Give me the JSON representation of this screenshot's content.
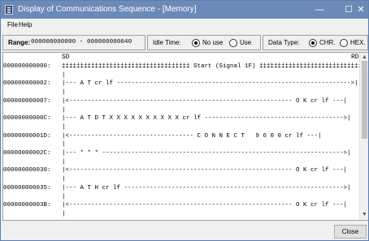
{
  "window": {
    "title": "Display of Communications Sequence - [Memory]",
    "minimize_glyph": "—",
    "maximize_glyph": "☐",
    "close_glyph": "✕"
  },
  "menu": {
    "file": "File",
    "help": "Help"
  },
  "range": {
    "label": "Range:",
    "value": "000000000000 - 000000000040"
  },
  "idle_time": {
    "label": "Idle Time:",
    "options": [
      "No use",
      "Use"
    ],
    "selected": "No use"
  },
  "data_type": {
    "label": "Data Type:",
    "options": [
      "CHR.",
      "HEX."
    ],
    "selected": "CHR."
  },
  "columns": {
    "sd": "SD",
    "rd": "RD"
  },
  "rows": [
    {
      "addr": "000000000000:",
      "data": "‡‡‡‡‡‡‡‡‡‡‡‡‡‡‡‡‡‡‡‡‡‡‡‡‡‡‡‡‡‡‡‡‡‡‡ Start (Signal 1F) ‡‡‡‡‡‡‡‡‡‡‡‡‡‡‡‡‡‡‡‡‡‡‡‡‡‡‡‡‡‡‡‡‡‡"
    },
    {
      "addr": "",
      "data": "|"
    },
    {
      "addr": "000000000002:",
      "data": "|--- A T cr lf ---------------------------------------------------------------->|"
    },
    {
      "addr": "",
      "data": "|"
    },
    {
      "addr": "000000000007:",
      "data": "|<------------------------------------------------------------- O K cr lf ---|"
    },
    {
      "addr": "",
      "data": "|"
    },
    {
      "addr": "00000000000C:",
      "data": "|--- A T D T X X X X X X X X X X cr lf -------------------------------------->|"
    },
    {
      "addr": "",
      "data": "|"
    },
    {
      "addr": "00000000001D:",
      "data": "|<---------------------------------- C O N N E C T   9 6 0 0 cr lf ---|"
    },
    {
      "addr": "",
      "data": "|"
    },
    {
      "addr": "00000000002C:",
      "data": "|--- * * * ------------------------------------------------------------------>|"
    },
    {
      "addr": "",
      "data": "|"
    },
    {
      "addr": "000000000030:",
      "data": "|<------------------------------------------------------------- O K cr lf ---|"
    },
    {
      "addr": "",
      "data": "|"
    },
    {
      "addr": "000000000035:",
      "data": "|--- A T H cr lf ------------------------------------------------------------>|"
    },
    {
      "addr": "",
      "data": "|"
    },
    {
      "addr": "00000000003B:",
      "data": "|<------------------------------------------------------------- O K cr lf ---|"
    },
    {
      "addr": "",
      "data": "|"
    }
  ],
  "buttons": {
    "close": "Close"
  },
  "colors": {
    "titlebar": "#6c8ab8",
    "window_bg": "#f0f0f0"
  }
}
